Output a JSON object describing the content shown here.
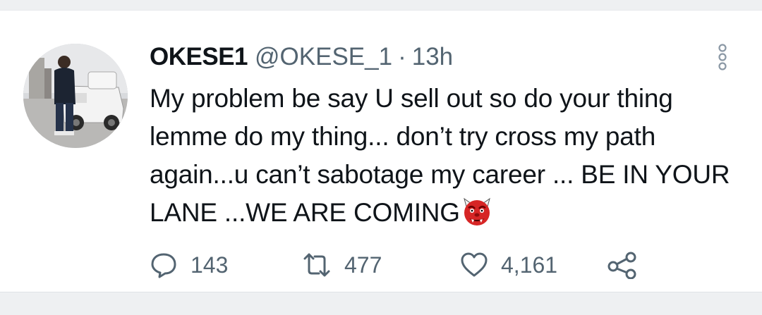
{
  "tweet": {
    "author_name": "OKESE1",
    "handle": "@OKESE_1",
    "separator": "·",
    "time": "13h",
    "text_main": "My problem be say U sell out so do your thing lemme do my thing... don’t try cross my path again...u can’t sabotage my career ... BE IN YOUR LANE ...WE ARE COMING",
    "emoji_icon": "ogre-face-emoji",
    "more_icon": "vertical-dots-icon"
  },
  "actions": {
    "reply_count": "143",
    "retweet_count": "477",
    "like_count": "4,161"
  },
  "colors": {
    "text": "#0f1419",
    "secondary": "#536471",
    "divider": "#eef0f2",
    "emoji_red": "#d62525"
  }
}
